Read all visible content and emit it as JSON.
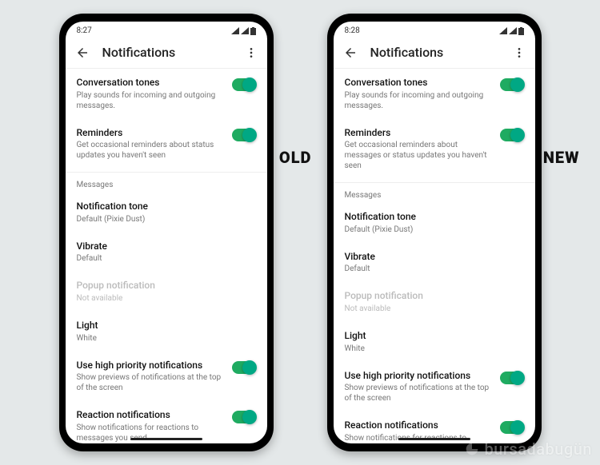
{
  "phones": [
    {
      "tag": "OLD",
      "status": {
        "time": "8:27"
      },
      "header": {
        "title": "Notifications"
      },
      "rows": [
        {
          "title": "Conversation tones",
          "sub": "Play sounds for incoming and outgoing messages.",
          "toggle": true
        },
        {
          "title": "Reminders",
          "sub": "Get occasional reminders about status updates you haven't seen",
          "toggle": true
        }
      ],
      "section": "Messages",
      "rows2": [
        {
          "title": "Notification tone",
          "sub": "Default (Pixie Dust)"
        },
        {
          "title": "Vibrate",
          "sub": "Default"
        },
        {
          "title": "Popup notification",
          "sub": "Not available",
          "disabled": true
        },
        {
          "title": "Light",
          "sub": "White"
        },
        {
          "title": "Use high priority notifications",
          "sub": "Show previews of notifications at the top of the screen",
          "toggle": true
        },
        {
          "title": "Reaction notifications",
          "sub": "Show notifications for reactions to messages you send",
          "toggle": true
        }
      ]
    },
    {
      "tag": "NEW",
      "status": {
        "time": "8:28"
      },
      "header": {
        "title": "Notifications"
      },
      "rows": [
        {
          "title": "Conversation tones",
          "sub": "Play sounds for incoming and outgoing messages.",
          "toggle": true
        },
        {
          "title": "Reminders",
          "sub": "Get occasional reminders about messages or status updates you haven't seen",
          "toggle": true
        }
      ],
      "section": "Messages",
      "rows2": [
        {
          "title": "Notification tone",
          "sub": "Default (Pixie Dust)"
        },
        {
          "title": "Vibrate",
          "sub": "Default"
        },
        {
          "title": "Popup notification",
          "sub": "Not available",
          "disabled": true
        },
        {
          "title": "Light",
          "sub": "White"
        },
        {
          "title": "Use high priority notifications",
          "sub": "Show previews of notifications at the top of the screen",
          "toggle": true
        },
        {
          "title": "Reaction notifications",
          "sub": "Show notifications for reactions to messages you send",
          "toggle": true
        }
      ]
    }
  ],
  "watermark": "bursadabugün"
}
